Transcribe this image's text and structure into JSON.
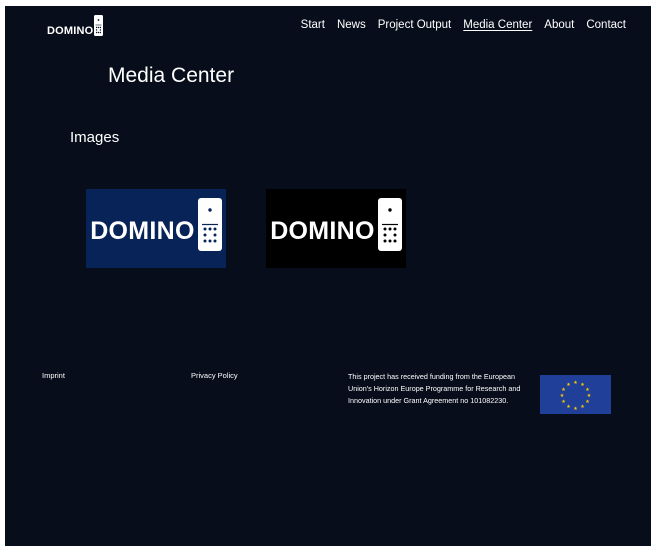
{
  "colors": {
    "page_background": "#070d1a",
    "text": "#ffffff",
    "image1_background": "#082358",
    "image2_background": "#000000",
    "eu_blue": "#1f3f99",
    "eu_star": "#ffcc00"
  },
  "header": {
    "logo_text": "DOMINO",
    "nav": [
      {
        "label": "Start",
        "active": false
      },
      {
        "label": "News",
        "active": false
      },
      {
        "label": "Project Output",
        "active": false
      },
      {
        "label": "Media Center",
        "active": true
      },
      {
        "label": "About",
        "active": false
      },
      {
        "label": "Contact",
        "active": false
      }
    ]
  },
  "main": {
    "title": "Media Center",
    "images_section": {
      "heading": "Images",
      "items": [
        {
          "logo_text": "DOMINO",
          "background": "blue"
        },
        {
          "logo_text": "DOMINO",
          "background": "black"
        }
      ]
    }
  },
  "footer": {
    "imprint": "Imprint",
    "privacy": "Privacy Policy",
    "funding_text": "This project has received funding from the European Union's Horizon Europe Programme for Research and Innovation under Grant Agreement no 101082230.",
    "flag_icon": "eu-flag-icon"
  }
}
